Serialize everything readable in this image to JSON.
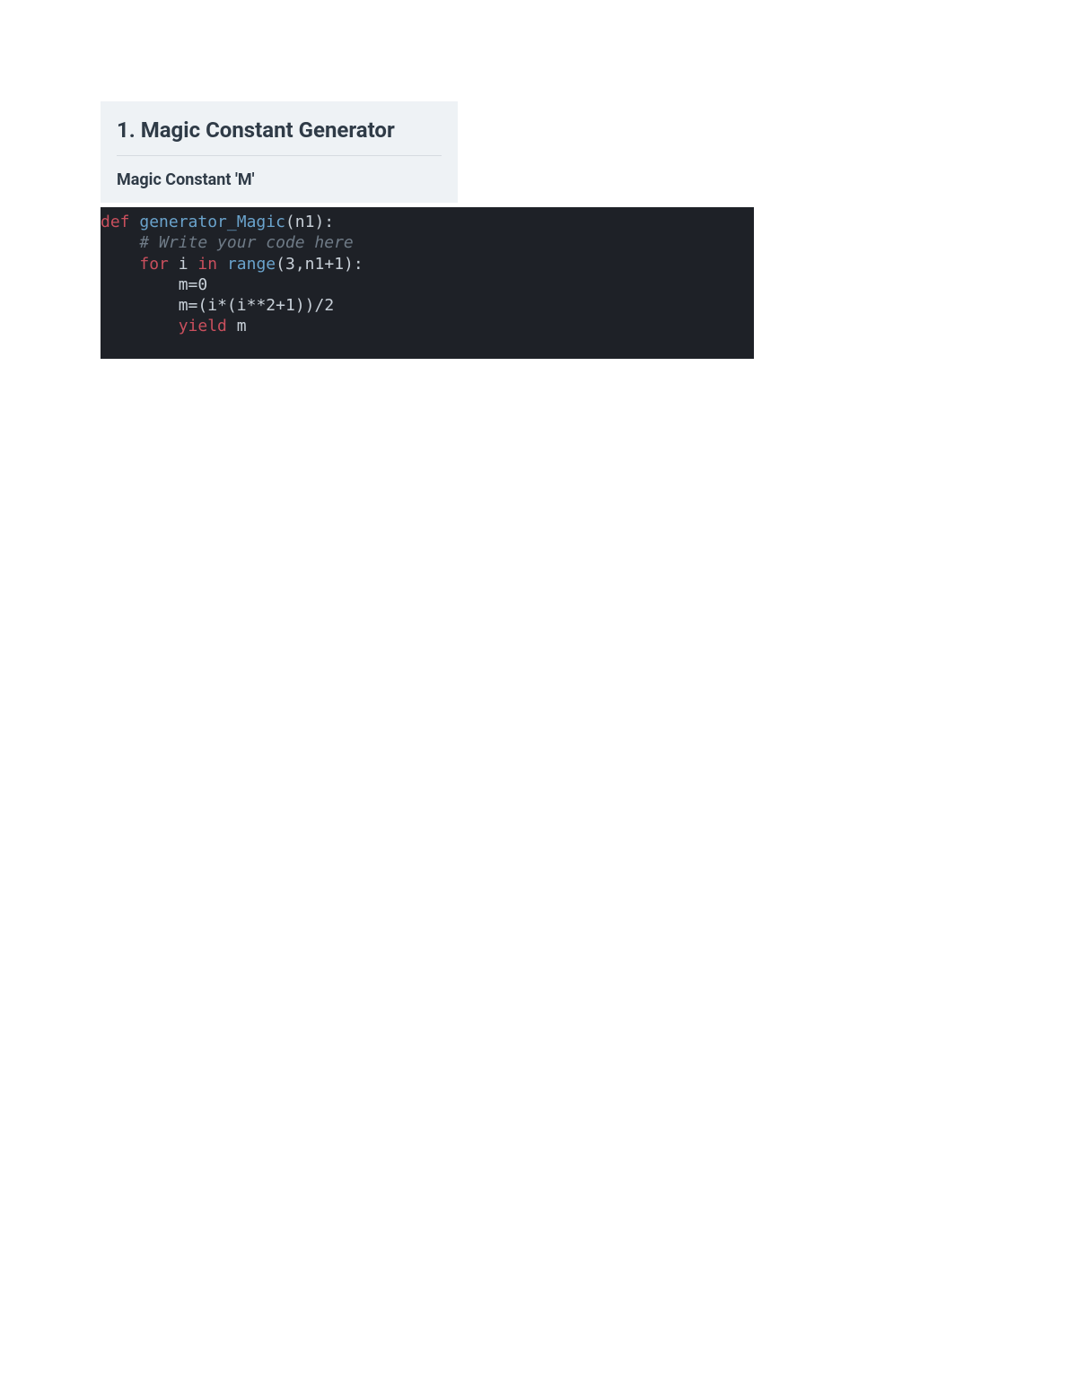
{
  "header": {
    "title": "1. Magic Constant Generator",
    "subtitle": "Magic Constant 'M'"
  },
  "code": {
    "line1": {
      "def": "def",
      "fn": "generator_Magic",
      "open": "(",
      "param": "n1",
      "close": "):"
    },
    "line2": {
      "indent": "    ",
      "comment": "# Write your code here"
    },
    "line3": {
      "indent": "    ",
      "for": "for",
      "i": "i",
      "in": "in",
      "range": "range",
      "open": "(",
      "three": "3",
      "comma": ",",
      "n1": "n1",
      "plus": "+",
      "one": "1",
      "close": "):"
    },
    "line4": {
      "indent": "        ",
      "m": "m",
      "eq": "=",
      "zero": "0"
    },
    "line5": {
      "indent": "        ",
      "m": "m",
      "eq": "=",
      "open1": "(",
      "i1": "i",
      "star1": "*",
      "open2": "(",
      "i2": "i",
      "pow": "**",
      "two": "2",
      "plus": "+",
      "one": "1",
      "close2": ")",
      "close1": ")",
      "slash": "/",
      "divtwo": "2"
    },
    "line6": {
      "indent": "        ",
      "yield": "yield",
      "m": "m"
    }
  }
}
